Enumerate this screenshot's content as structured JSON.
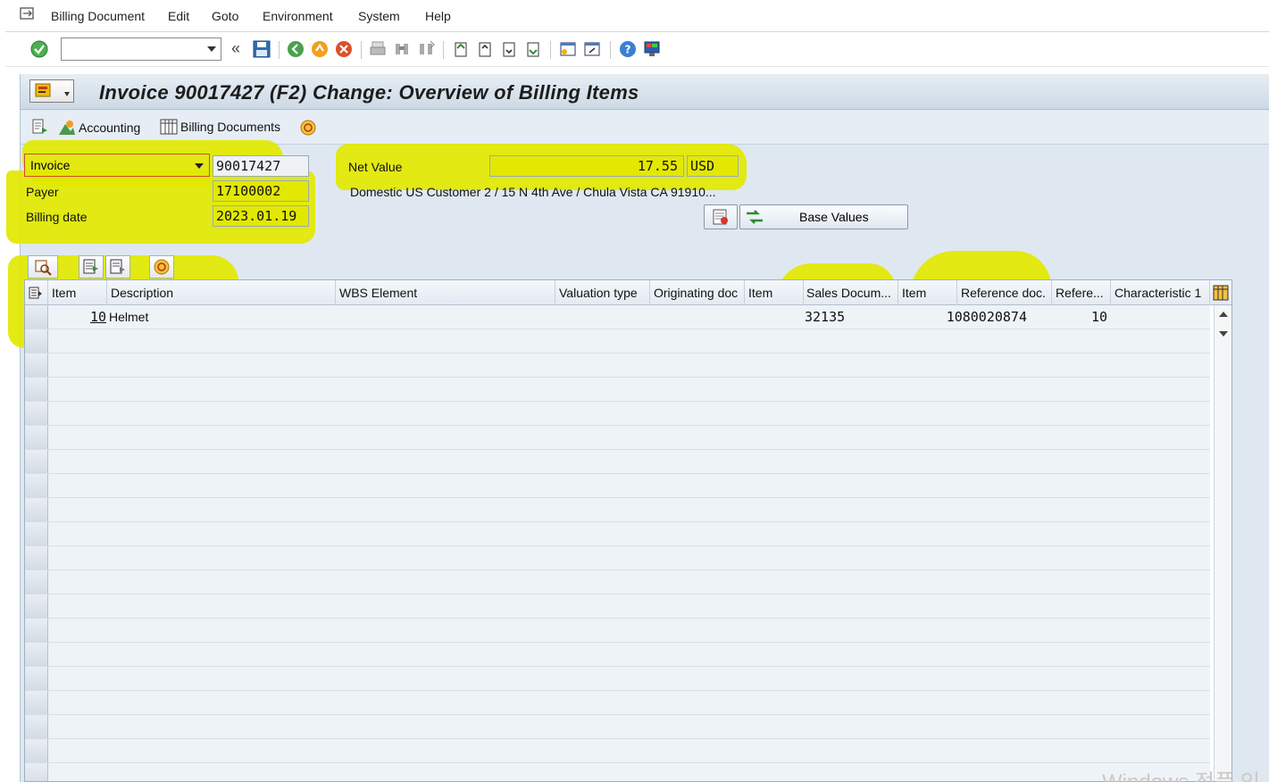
{
  "menu": {
    "items": [
      {
        "label": "Billing Document"
      },
      {
        "label": "Edit"
      },
      {
        "label": "Goto"
      },
      {
        "label": "Environment"
      },
      {
        "label": "System"
      },
      {
        "label": "Help"
      }
    ]
  },
  "toolbar": {
    "command_value": "",
    "collapse_label": "«"
  },
  "title": {
    "text": "Invoice 90017427  (F2) Change: Overview of Billing Items"
  },
  "appbar": {
    "accounting_label": "Accounting",
    "billing_documents_label": "Billing Documents"
  },
  "header": {
    "doc_type_value": "Invoice",
    "doc_number": "90017427",
    "payer_label": "Payer",
    "payer_value": "17100002",
    "billing_date_label": "Billing date",
    "billing_date_value": "2023.01.19",
    "net_value_label": "Net Value",
    "net_value": "17.55",
    "currency": "USD",
    "payer_address": "Domestic US Customer 2 / 15 N 4th Ave / Chula Vista CA 91910...",
    "base_values_label": "Base Values"
  },
  "table": {
    "columns": [
      "Item",
      "Description",
      "WBS Element",
      "Valuation type",
      "Originating doc",
      "Item",
      "Sales Docum...",
      "Item",
      "Reference doc.",
      "Refere...",
      "Characteristic 1"
    ],
    "rows": [
      {
        "item": "10",
        "description": "Helmet",
        "wbs": "",
        "valuation_type": "",
        "originating_doc": "",
        "orig_item": "",
        "sales_doc": "32135",
        "sales_item": "",
        "reference_doc": "1080020874",
        "ref_item": "10",
        "characteristic1": ""
      }
    ]
  },
  "watermark": "Windows 정품 인"
}
